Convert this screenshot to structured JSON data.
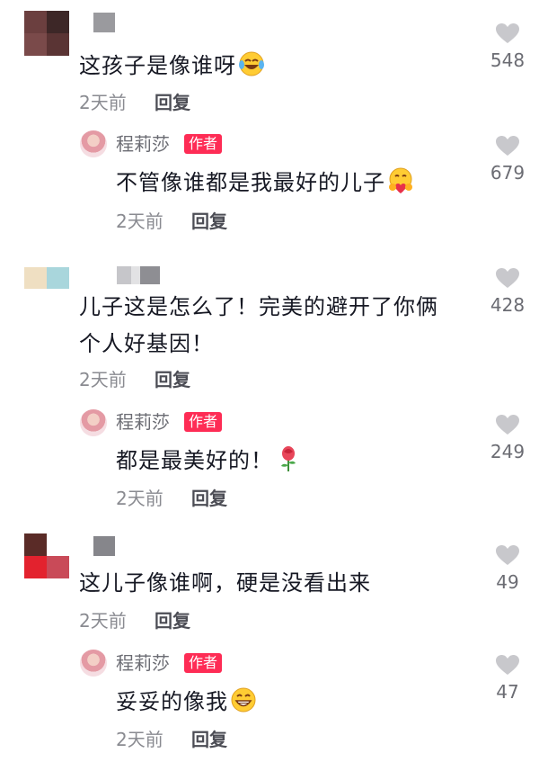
{
  "comments": [
    {
      "text": "这孩子是像谁呀",
      "emoji": "laughing-tears-emoji",
      "time": "2天前",
      "reply_label": "回复",
      "likes": "548",
      "reply": {
        "author": "程莉莎",
        "badge": "作者",
        "text": "不管像谁都是我最好的儿子",
        "emoji": "hug-heart-emoji",
        "time": "2天前",
        "reply_label": "回复",
        "likes": "679"
      }
    },
    {
      "text_line1": "儿子这是怎么了！完美的避开了你俩",
      "text_line2": "个人好基因！",
      "time": "2天前",
      "reply_label": "回复",
      "likes": "428",
      "reply": {
        "author": "程莉莎",
        "badge": "作者",
        "text": "都是最美好的！",
        "emoji": "rose-emoji",
        "time": "2天前",
        "reply_label": "回复",
        "likes": "249"
      }
    },
    {
      "text": "这儿子像谁啊，硬是没看出来",
      "time": "2天前",
      "reply_label": "回复",
      "likes": "49",
      "reply": {
        "author": "程莉莎",
        "badge": "作者",
        "text": "妥妥的像我",
        "emoji": "grin-emoji",
        "time": "2天前",
        "reply_label": "回复",
        "likes": "47"
      }
    }
  ],
  "colors": {
    "badge": "#fe2c55",
    "like_icon": "#c8c8cc",
    "meta_text": "#8a8b91"
  },
  "icons": [
    "heart-icon"
  ]
}
